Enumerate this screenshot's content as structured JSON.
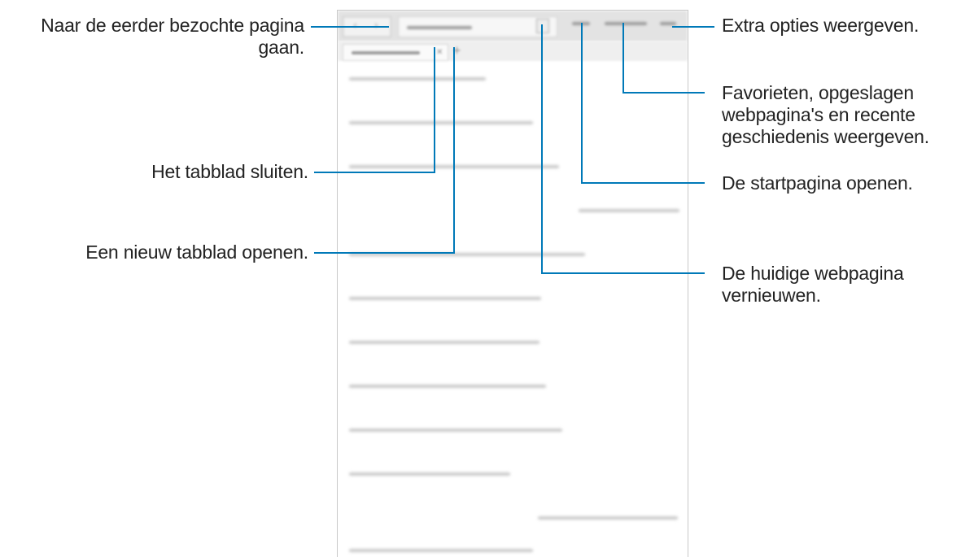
{
  "callouts": {
    "back_forward": [
      "Naar de eerder bezochte pagina",
      "gaan."
    ],
    "close_tab": "Het tabblad sluiten.",
    "new_tab": "Een nieuw tabblad openen.",
    "extra_options": "Extra opties weergeven.",
    "bookmarks": [
      "Favorieten, opgeslagen",
      "webpagina's en recente",
      "geschiedenis weergeven."
    ],
    "home": "De startpagina openen.",
    "refresh": [
      "De huidige webpagina",
      "vernieuwen."
    ]
  },
  "browser": {
    "back_icon": "chevron-left-icon",
    "forward_icon": "chevron-right-icon",
    "close_icon": "close-icon",
    "new_tab_icon": "plus-icon",
    "refresh_icon": "refresh-icon"
  },
  "colors": {
    "leader_line": "#0079b8",
    "text": "#222222"
  }
}
